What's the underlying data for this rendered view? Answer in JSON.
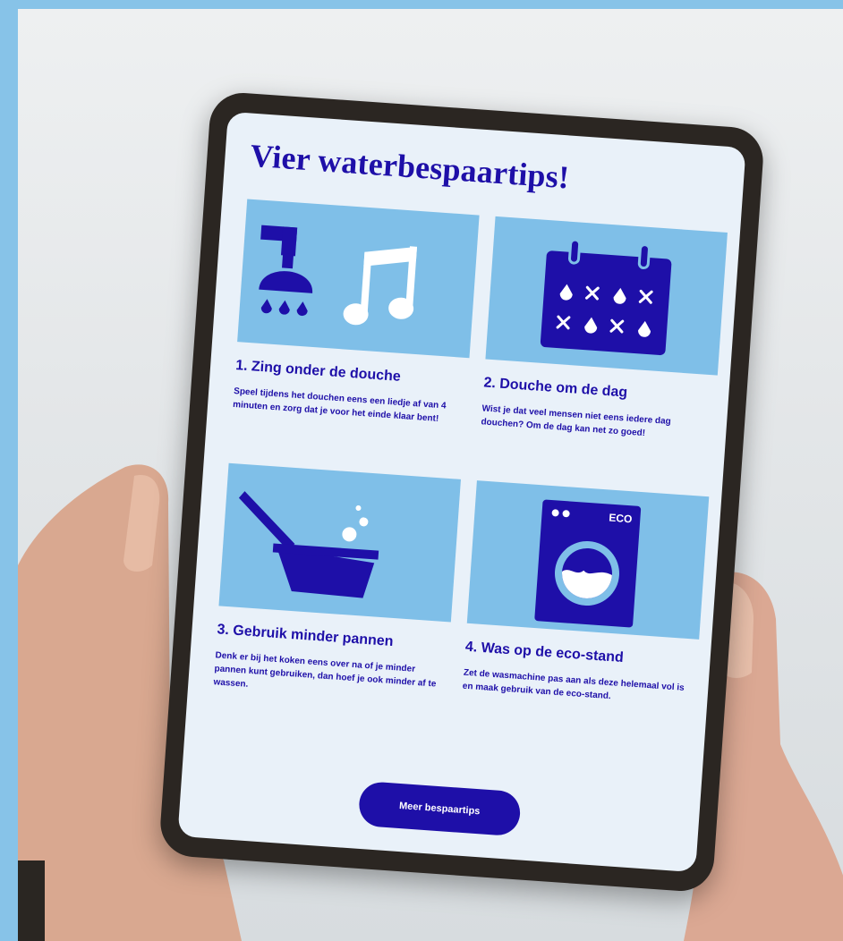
{
  "title": "Vier waterbespaartips!",
  "tips": [
    {
      "heading": "1. Zing onder de douche",
      "body": "Speel tijdens het douchen eens een liedje af van 4 minuten en zorg dat je voor het einde klaar bent!",
      "icon": "shower-music-icon"
    },
    {
      "heading": "2. Douche om de dag",
      "body": "Wist je dat veel mensen niet eens iedere dag douchen? Om de dag kan net zo goed!",
      "icon": "calendar-drops-icon"
    },
    {
      "heading": "3. Gebruik minder pannen",
      "body": "Denk er bij het koken eens over na of je minder pannen kunt gebruiken, dan hoef je ook minder af te wassen.",
      "icon": "pan-bubbles-icon"
    },
    {
      "heading": "4. Was op de eco-stand",
      "body": "Zet de wasmachine pas aan als deze helemaal vol is en maak gebruik van de eco-stand.",
      "icon": "washing-machine-icon",
      "icon_label": "ECO"
    }
  ],
  "cta_label": "Meer bespaartips",
  "colors": {
    "brand": "#1e0fa8",
    "tile": "#7fbfe8",
    "frame": "#87c3e8",
    "screen": "#e9f1f9"
  }
}
